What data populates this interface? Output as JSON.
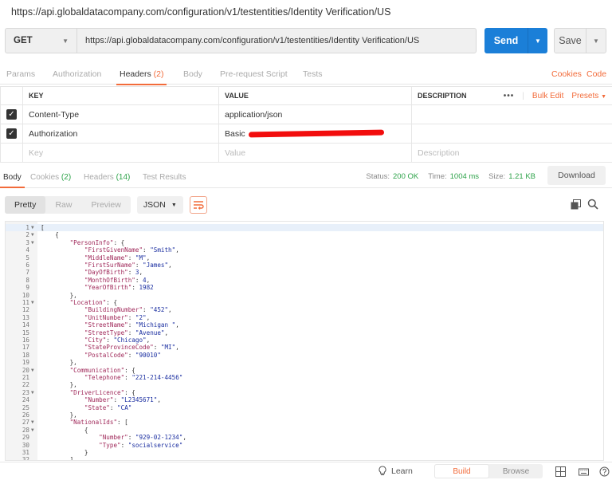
{
  "title_url": "https://api.globaldatacompany.com/configuration/v1/testentities/Identity Verification/US",
  "request": {
    "method": "GET",
    "url": "https://api.globaldatacompany.com/configuration/v1/testentities/Identity Verification/US",
    "send_label": "Send",
    "save_label": "Save"
  },
  "request_tabs": [
    {
      "label": "Params"
    },
    {
      "label": "Authorization"
    },
    {
      "label": "Headers",
      "count": "(2)"
    },
    {
      "label": "Body"
    },
    {
      "label": "Pre-request Script"
    },
    {
      "label": "Tests"
    }
  ],
  "request_links": {
    "cookies": "Cookies",
    "code": "Code"
  },
  "headers_table": {
    "columns": {
      "key": "KEY",
      "value": "VALUE",
      "description": "DESCRIPTION"
    },
    "more": "•••",
    "bulk_edit": "Bulk Edit",
    "presets": "Presets",
    "rows": [
      {
        "key": "Content-Type",
        "value": "application/json",
        "checked": true
      },
      {
        "key": "Authorization",
        "value": "Basic",
        "checked": true
      }
    ],
    "placeholders": {
      "key": "Key",
      "value": "Value",
      "description": "Description"
    }
  },
  "response_tabs": [
    {
      "label": "Body"
    },
    {
      "label": "Cookies",
      "count": "(2)"
    },
    {
      "label": "Headers",
      "count": "(14)"
    },
    {
      "label": "Test Results"
    }
  ],
  "response_status": {
    "status_label": "Status:",
    "status_value": "200 OK",
    "time_label": "Time:",
    "time_value": "1004 ms",
    "size_label": "Size:",
    "size_value": "1.21 KB"
  },
  "download_label": "Download",
  "view_modes": [
    "Pretty",
    "Raw",
    "Preview"
  ],
  "format": "JSON",
  "code_lines": [
    "[",
    "    {",
    "        \"PersonInfo\": {",
    "            \"FirstGivenName\": \"Smith\",",
    "            \"MiddleName\": \"M\",",
    "            \"FirstSurName\": \"James\",",
    "            \"DayOfBirth\": 3,",
    "            \"MonthOfBirth\": 4,",
    "            \"YearOfBirth\": 1982",
    "        },",
    "        \"Location\": {",
    "            \"BuildingNumber\": \"452\",",
    "            \"UnitNumber\": \"2\",",
    "            \"StreetName\": \"Michigan \",",
    "            \"StreetType\": \"Avenue\",",
    "            \"City\": \"Chicago\",",
    "            \"StateProvinceCode\": \"MI\",",
    "            \"PostalCode\": \"90010\"",
    "        },",
    "        \"Communication\": {",
    "            \"Telephone\": \"221-214-4456\"",
    "        },",
    "        \"DriverLicence\": {",
    "            \"Number\": \"L2345671\",",
    "            \"State\": \"CA\"",
    "        },",
    "        \"NationalIds\": [",
    "            {",
    "                \"Number\": \"929-02-1234\",",
    "                \"Type\": \"socialservice\"",
    "            }",
    "        ]",
    "    }"
  ],
  "fold_lines": [
    1,
    2,
    3,
    11,
    20,
    23,
    27,
    28
  ],
  "footer": {
    "learn": "Learn",
    "build": "Build",
    "browse": "Browse"
  },
  "colors": {
    "accent": "#f26b3a",
    "primary": "#1b7fd8",
    "success": "#2ea34a"
  }
}
